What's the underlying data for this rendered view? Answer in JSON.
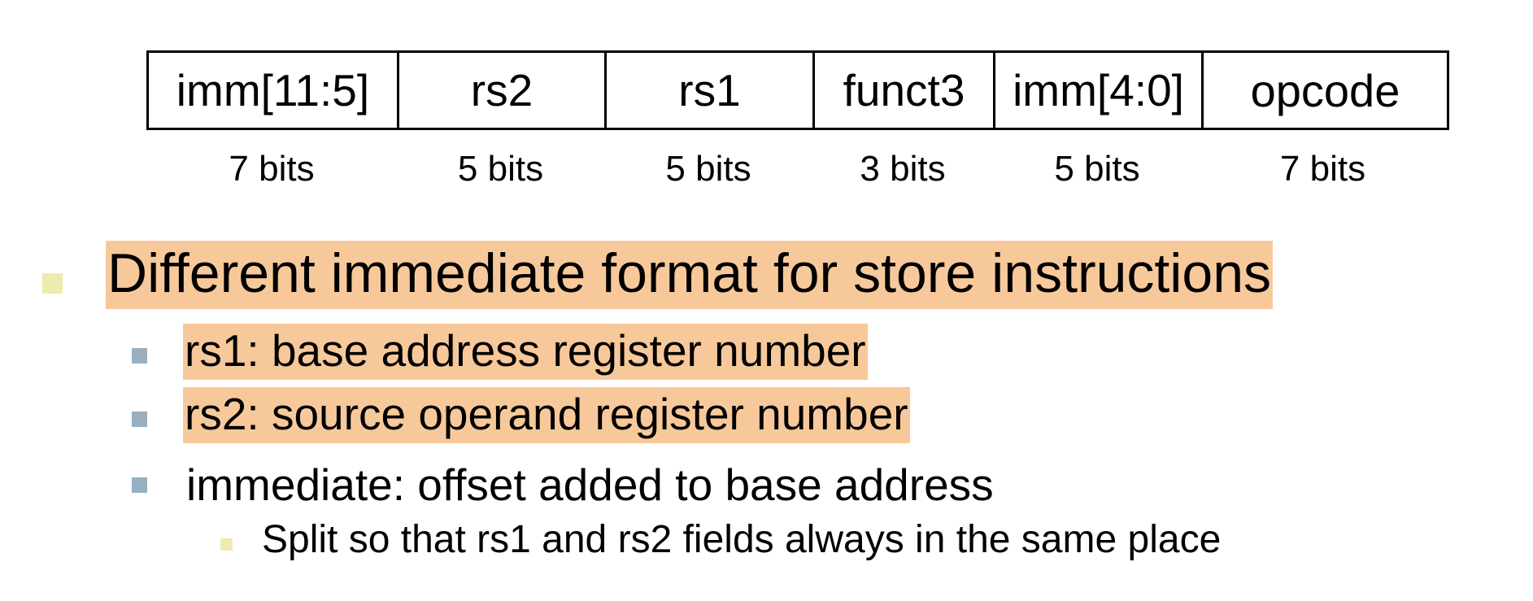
{
  "format": {
    "fields": [
      {
        "label": "imm[11:5]",
        "bits": "7 bits"
      },
      {
        "label": "rs2",
        "bits": "5 bits"
      },
      {
        "label": "rs1",
        "bits": "5 bits"
      },
      {
        "label": "funct3",
        "bits": "3 bits"
      },
      {
        "label": "imm[4:0]",
        "bits": "5 bits"
      },
      {
        "label": "opcode",
        "bits": "7 bits"
      }
    ]
  },
  "bullets": {
    "main": "Different immediate format for store instructions",
    "sub": [
      "rs1: base address register number",
      "rs2: source operand register number",
      "immediate: offset added to base address"
    ],
    "subsub": [
      "Split so that rs1 and rs2 fields always in the same place"
    ]
  },
  "colors": {
    "highlight": "#f7c99a",
    "level1_marker": "#eeeab0",
    "level2_marker": "#97b0c1",
    "level3_marker": "#eeeab0"
  }
}
